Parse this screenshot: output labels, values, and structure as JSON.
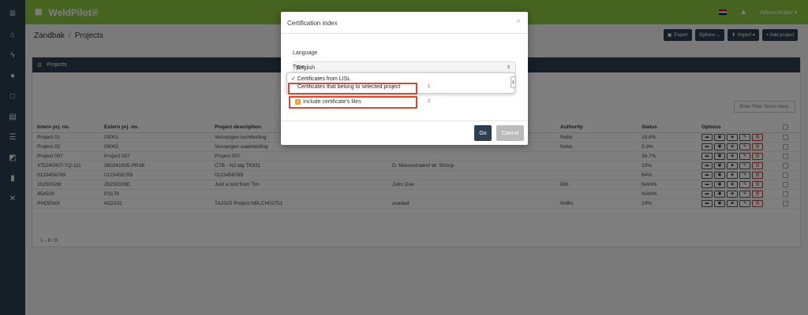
{
  "app": {
    "brand": "WeldPilot®",
    "user": "Administrator ▾"
  },
  "breadcrumb": {
    "root": "Zandbak",
    "sep": "/",
    "current": "Projects"
  },
  "toolbar": {
    "export": "Export",
    "options": "Options ⌄",
    "import": "Import ▾",
    "add": "+ Add project"
  },
  "panel": {
    "title": "Projects",
    "filter_placeholder": "Enter Filter Terms Here."
  },
  "table": {
    "headers": [
      "Intern prj. no.",
      "Extern prj. no.",
      "Project description",
      "",
      "Authority",
      "Status",
      "Options"
    ],
    "rows": [
      [
        "Project 01",
        "00001",
        "Vervangen luchtleiding",
        "",
        "Nobo",
        "19.8%"
      ],
      [
        "Project 02",
        "00002",
        "Vervangen waterleiding",
        "",
        "Nobo",
        "3.3%"
      ],
      [
        "Project 007",
        "Project 007",
        "Project 007",
        "",
        "",
        "36.7%"
      ],
      [
        "375240007-TQ-111",
        "360241005-PR38",
        "CTB - N2 ldg TK831",
        "D. Nieuwstraten/ W. Stroop",
        "",
        "10%"
      ],
      [
        "0123456789",
        "0123456789",
        "0123456789",
        "",
        "",
        "64%"
      ],
      [
        "20250328I",
        "20250328E",
        "Just a test from Tim",
        "John Doe",
        "IDK",
        "NAN%"
      ],
      [
        "454509",
        "P3179",
        "",
        "",
        "",
        "NAN%"
      ],
      [
        "PHOENIX",
        "N22101",
        "TA2025 Project NBLCH02751",
        "asadad",
        "NoBo",
        "10%"
      ]
    ],
    "pager": "1 - 8 / 8"
  },
  "modal": {
    "title": "Certification index",
    "close": "×",
    "language_label": "Language",
    "language_value": "English",
    "type_label": "Type",
    "type_option_1": "✓ Certificates from LISL",
    "type_option_2": "Certificates that belong to selected project",
    "marker_1": "1",
    "include_label": "Include certificate's files",
    "marker_2": "2",
    "go": "Go",
    "cancel": "Cancel"
  },
  "colors": {
    "topbar": "#8dc63f",
    "nav": "#2c3e50",
    "highlight": "#d9442e",
    "checkbox": "#f0a030"
  }
}
